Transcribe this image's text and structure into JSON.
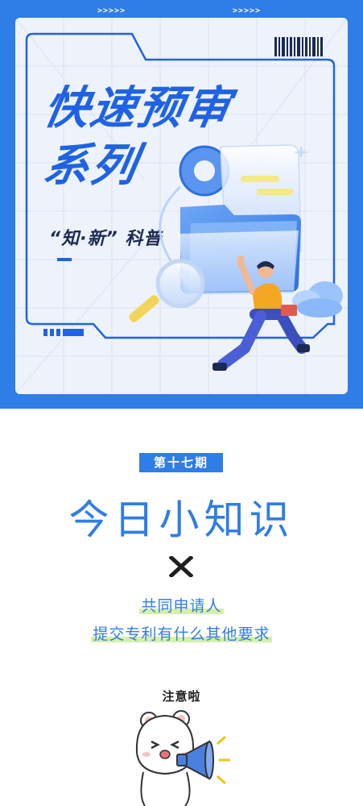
{
  "banner": {
    "arrows_left": ">>>>>",
    "arrows_right": ">>>>>",
    "title_line1": "快速预审",
    "title_line2": "系列",
    "subtitle_open_quote": "“",
    "subtitle_quoted": "知·新",
    "subtitle_close_quote": "”",
    "subtitle_rest": "科普",
    "colors": {
      "frame": "#2f7de6",
      "title": "#1f63e4",
      "panel": "#eef3fb"
    }
  },
  "article": {
    "issue_badge": "第十七期",
    "headline": "今日小知识",
    "line1": "共同申请人",
    "line2": "提交专利有什么其他要求",
    "notice": "注意啦",
    "colors": {
      "accent": "#2f7de6",
      "highlight": "#d6f0a8"
    }
  },
  "icons": [
    "barcode-icon",
    "magnifier-icon",
    "folder-icon",
    "cloud-icon",
    "x-mark-icon",
    "bear-mascot-icon",
    "megaphone-icon"
  ]
}
